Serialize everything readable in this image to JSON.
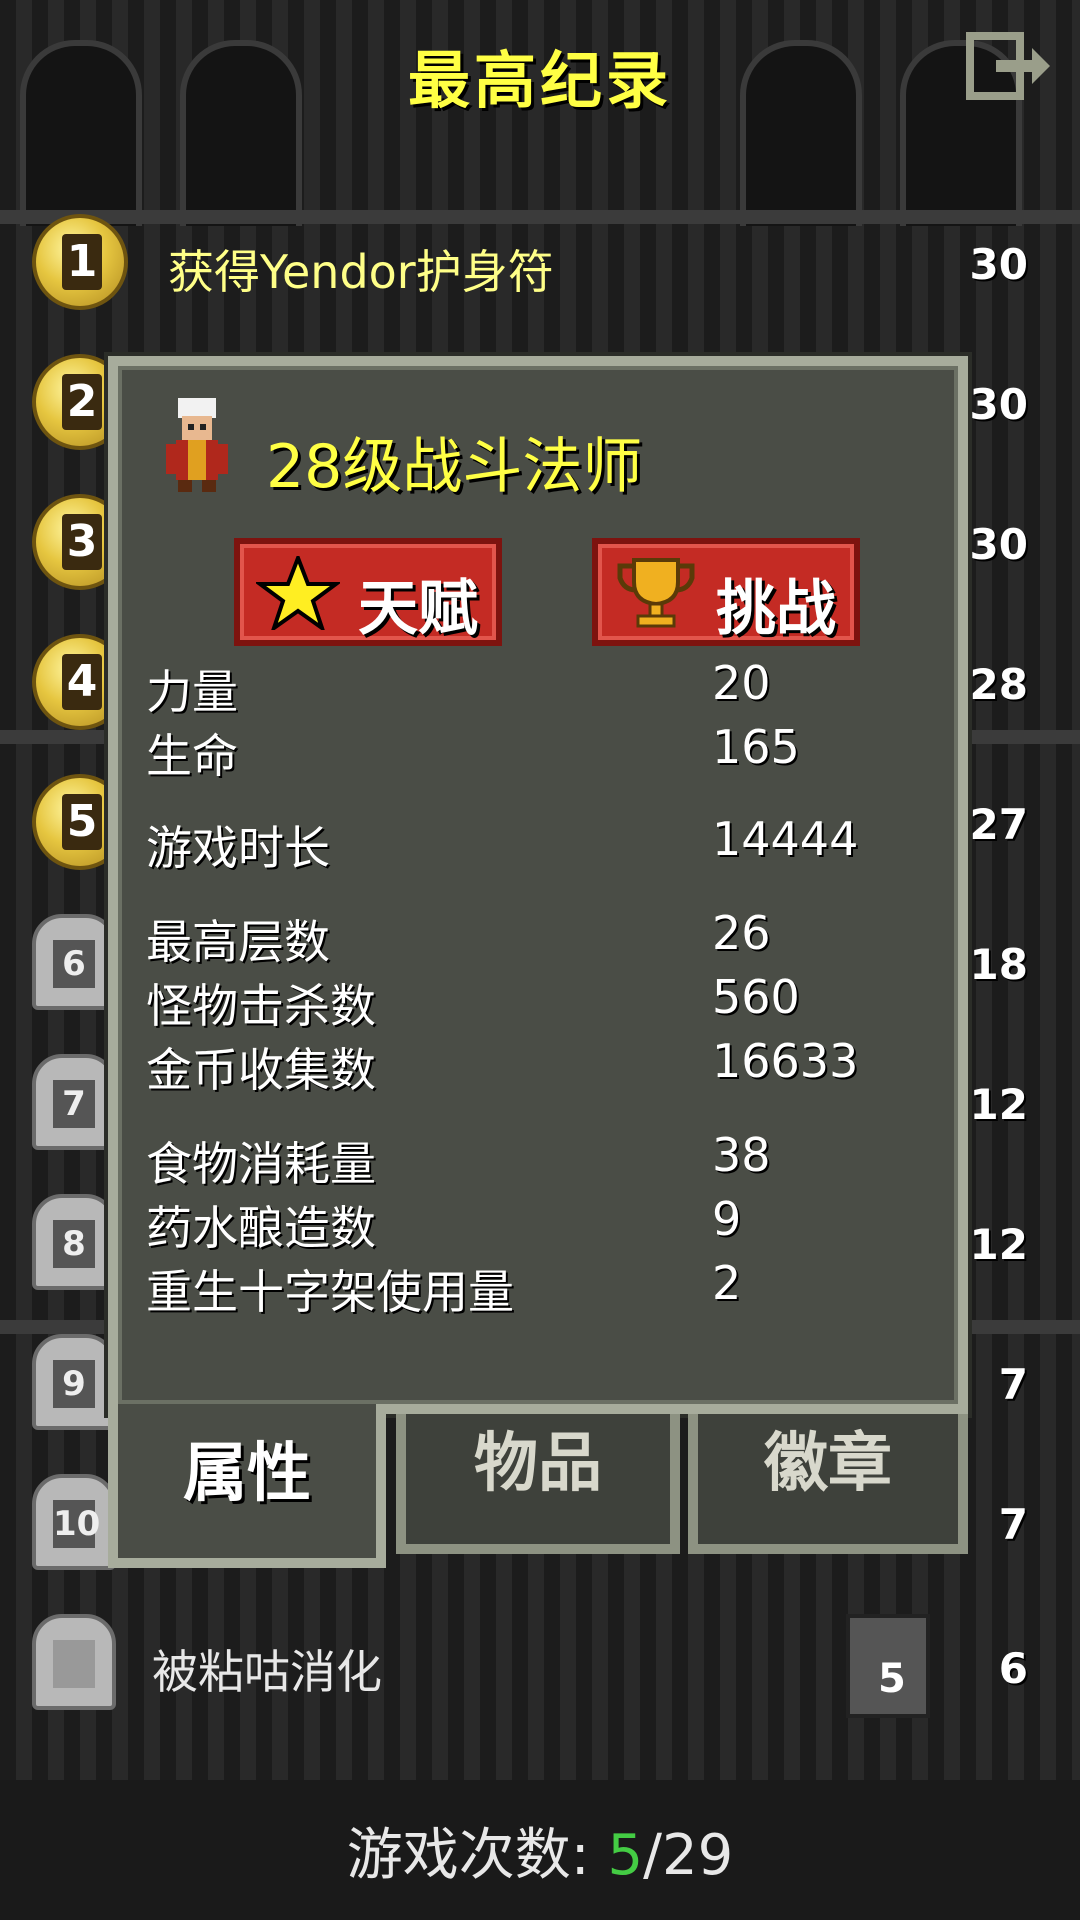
{
  "header": {
    "title": "最高纪录",
    "exit_icon": "exit-icon"
  },
  "records": [
    {
      "rank": "1",
      "text": "获得Yendor护身符",
      "score": "30",
      "kind": "medal"
    },
    {
      "rank": "2",
      "text": "",
      "score": "30",
      "kind": "medal"
    },
    {
      "rank": "3",
      "text": "",
      "score": "30",
      "kind": "medal"
    },
    {
      "rank": "4",
      "text": "",
      "score": "28",
      "kind": "medal"
    },
    {
      "rank": "5",
      "text": "",
      "score": "27",
      "kind": "medal"
    },
    {
      "rank": "6",
      "text": "",
      "score": "18",
      "kind": "tomb"
    },
    {
      "rank": "7",
      "text": "",
      "score": "12",
      "kind": "tomb"
    },
    {
      "rank": "8",
      "text": "",
      "score": "12",
      "kind": "tomb"
    },
    {
      "rank": "9",
      "text": "",
      "score": "7",
      "kind": "tomb"
    },
    {
      "rank": "10",
      "text": "",
      "score": "7",
      "kind": "tomb"
    },
    {
      "rank": "",
      "text": "被粘咕消化",
      "score": "6",
      "depth": "5",
      "kind": "tomb"
    }
  ],
  "modal": {
    "hero_title": "28级战斗法师",
    "talents_label": "天赋",
    "challenges_label": "挑战",
    "stats": [
      {
        "label": "力量",
        "value": "20"
      },
      {
        "label": "生命",
        "value": "165"
      },
      {
        "label": "游戏时长",
        "value": "14444"
      },
      {
        "label": "最高层数",
        "value": "26"
      },
      {
        "label": "怪物击杀数",
        "value": "560"
      },
      {
        "label": "金币收集数",
        "value": "16633"
      },
      {
        "label": "食物消耗量",
        "value": "38"
      },
      {
        "label": "药水酿造数",
        "value": "9"
      },
      {
        "label": "重生十字架使用量",
        "value": "2"
      }
    ],
    "tabs": {
      "stats": "属性",
      "items": "物品",
      "badges": "徽章"
    }
  },
  "footer": {
    "label": "游戏次数:",
    "current": "5",
    "total": "/29"
  },
  "colors": {
    "accent_yellow": "#ffff44",
    "button_red": "#c42b24",
    "panel": "#4a4d46",
    "count_green": "#44cc44"
  }
}
